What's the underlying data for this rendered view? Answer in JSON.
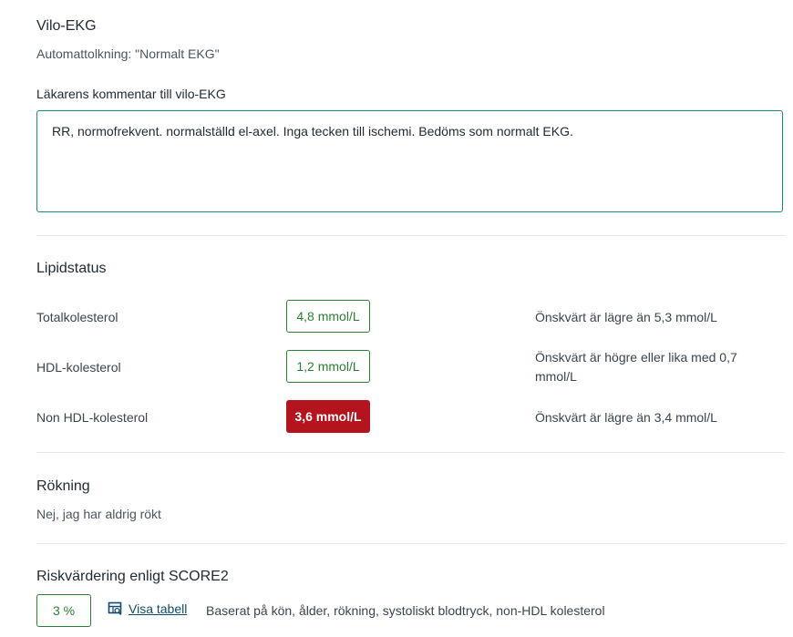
{
  "ekg": {
    "title": "Vilo-EKG",
    "auto_interpretation": "Automattolkning: \"Normalt EKG\"",
    "comment_label": "Läkarens kommentar till vilo-EKG",
    "comment_value": "RR, normofrekvent. normalställd el-axel. Inga tecken till ischemi. Bedöms som normalt EKG."
  },
  "lipid": {
    "title": "Lipidstatus",
    "rows": [
      {
        "label": "Totalkolesterol",
        "value": "4,8 mmol/L",
        "reference": "Önskvärt är lägre än 5,3 mmol/L",
        "status": "normal"
      },
      {
        "label": "HDL-kolesterol",
        "value": "1,2 mmol/L",
        "reference": "Önskvärt är högre eller lika med 0,7 mmol/L",
        "status": "normal"
      },
      {
        "label": "Non HDL-kolesterol",
        "value": "3,6 mmol/L",
        "reference": "Önskvärt är lägre än 3,4 mmol/L",
        "status": "alert"
      }
    ]
  },
  "smoking": {
    "title": "Rökning",
    "value": "Nej, jag har aldrig rökt"
  },
  "risk": {
    "title": "Riskvärdering enligt SCORE2",
    "score": "3 %",
    "table_link": "Visa tabell",
    "table_icon": "table-icon",
    "description": "Baserat på kön, ålder, rökning, systoliskt blodtryck, non-HDL kolesterol"
  },
  "colors": {
    "accent": "#1e8a7a",
    "normal": "#2e7d32",
    "alert": "#b3141d",
    "link": "#0f4d6b"
  }
}
